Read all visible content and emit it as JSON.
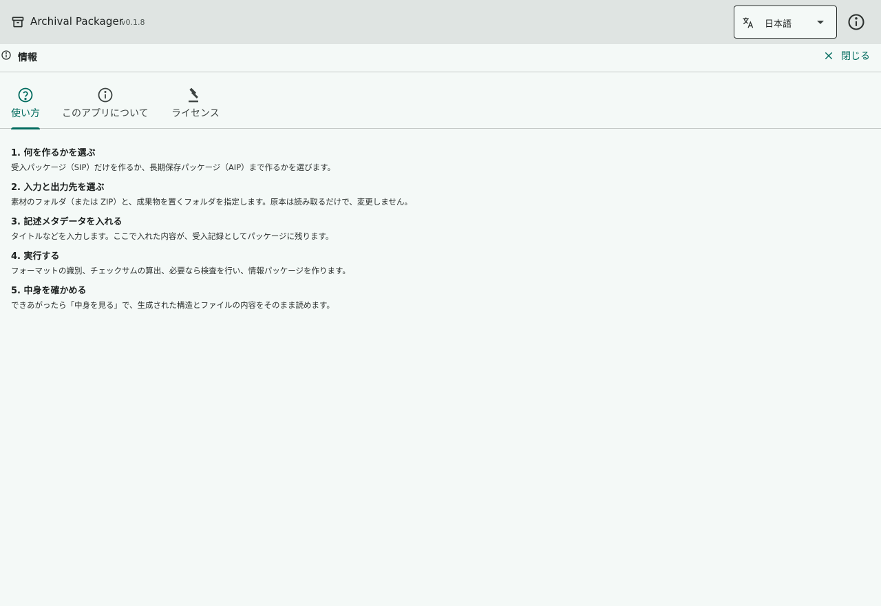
{
  "topbar": {
    "title": "Archival Packager",
    "version": "v0.1.8",
    "language": "日本語"
  },
  "panel": {
    "title": "情報",
    "close_label": "閉じる"
  },
  "tabs": [
    {
      "label": "使い方",
      "icon": "help-circle-icon",
      "active": true
    },
    {
      "label": "このアプリについて",
      "icon": "info-icon",
      "active": false
    },
    {
      "label": "ライセンス",
      "icon": "gavel-icon",
      "active": false
    }
  ],
  "steps": [
    {
      "title": "1. 何を作るかを選ぶ",
      "desc": "受入パッケージ（SIP）だけを作るか、長期保存パッケージ（AIP）まで作るかを選びます。"
    },
    {
      "title": "2. 入力と出力先を選ぶ",
      "desc": "素材のフォルダ（または ZIP）と、成果物を置くフォルダを指定します。原本は読み取るだけで、変更しません。"
    },
    {
      "title": "3. 記述メタデータを入れる",
      "desc": "タイトルなどを入力します。ここで入れた内容が、受入記録としてパッケージに残ります。"
    },
    {
      "title": "4. 実行する",
      "desc": "フォーマットの識別、チェックサムの算出、必要なら検査を行い、情報パッケージを作ります。"
    },
    {
      "title": "5. 中身を確かめる",
      "desc": "できあがったら「中身を見る」で、生成された構造とファイルの内容をそのまま読めます。"
    }
  ],
  "colors": {
    "accent": "#006b5e",
    "topbar_bg": "#dfe4e2",
    "page_bg": "#f4f9f7"
  }
}
